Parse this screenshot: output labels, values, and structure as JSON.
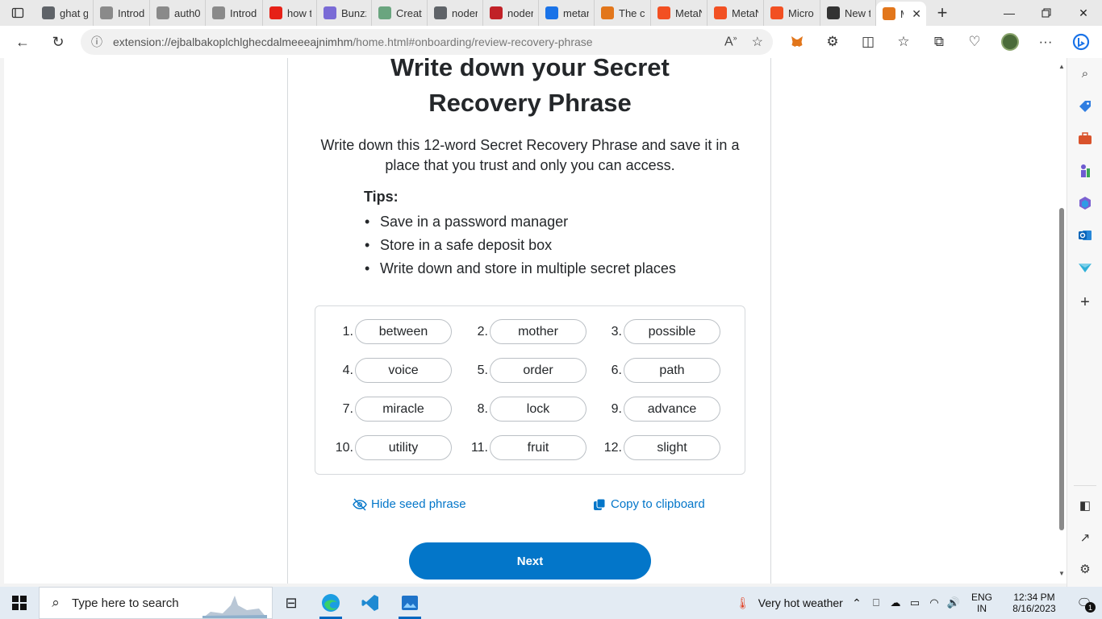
{
  "browser": {
    "tabs": [
      {
        "title": "ghat g",
        "icon": "search-icon",
        "color": "#5f6368"
      },
      {
        "title": "Introd",
        "icon": "openai-icon",
        "color": "#8a8a8a"
      },
      {
        "title": "auth0",
        "icon": "page-icon",
        "color": "#8a8a8a"
      },
      {
        "title": "Introd",
        "icon": "openai-icon",
        "color": "#8a8a8a"
      },
      {
        "title": "how t",
        "icon": "youtube-icon",
        "color": "#e62117"
      },
      {
        "title": "Bunzz",
        "icon": "bunzz-icon",
        "color": "#7a6bd6"
      },
      {
        "title": "Create",
        "icon": "openai-icon",
        "color": "#6aa57f"
      },
      {
        "title": "noder",
        "icon": "search-icon",
        "color": "#5f6368"
      },
      {
        "title": "noder",
        "icon": "npm-icon",
        "color": "#c12127"
      },
      {
        "title": "metan",
        "icon": "search-icon",
        "color": "#1a73e8"
      },
      {
        "title": "The cr",
        "icon": "metamask-icon",
        "color": "#e2761b"
      },
      {
        "title": "MetaN",
        "icon": "microsoft-icon",
        "color": "#f25022"
      },
      {
        "title": "MetaN",
        "icon": "microsoft-icon",
        "color": "#f25022"
      },
      {
        "title": "Micro",
        "icon": "microsoft-icon",
        "color": "#f25022"
      },
      {
        "title": "New t",
        "icon": "newtab-icon",
        "color": "#333333"
      },
      {
        "title": "M",
        "icon": "metamask-icon",
        "color": "#e2761b",
        "active": true
      }
    ],
    "url_host": "extension://ejbalbakoplchlghecdalmeeeajnimhm",
    "url_rest": "/home.html#onboarding/review-recovery-phrase"
  },
  "page": {
    "heading_line1": "Write down your Secret",
    "heading_line2": "Recovery Phrase",
    "subtext": "Write down this 12-word Secret Recovery Phrase and save it in a place that you trust and only you can access.",
    "tips_title": "Tips:",
    "tips": [
      "Save in a password manager",
      "Store in a safe deposit box",
      "Write down and store in multiple secret places"
    ],
    "words": [
      {
        "num": "1.",
        "word": "between"
      },
      {
        "num": "2.",
        "word": "mother"
      },
      {
        "num": "3.",
        "word": "possible"
      },
      {
        "num": "4.",
        "word": "voice"
      },
      {
        "num": "5.",
        "word": "order"
      },
      {
        "num": "6.",
        "word": "path"
      },
      {
        "num": "7.",
        "word": "miracle"
      },
      {
        "num": "8.",
        "word": "lock"
      },
      {
        "num": "9.",
        "word": "advance"
      },
      {
        "num": "10.",
        "word": "utility"
      },
      {
        "num": "11.",
        "word": "fruit"
      },
      {
        "num": "12.",
        "word": "slight"
      }
    ],
    "hide_label": "Hide seed phrase",
    "copy_label": "Copy to clipboard",
    "next_label": "Next",
    "accent": "#0376c9"
  },
  "taskbar": {
    "search_placeholder": "Type here to search",
    "weather": "Very hot weather",
    "lang_top": "ENG",
    "lang_bottom": "IN",
    "time": "12:34 PM",
    "date": "8/16/2023",
    "notification_count": "1"
  }
}
